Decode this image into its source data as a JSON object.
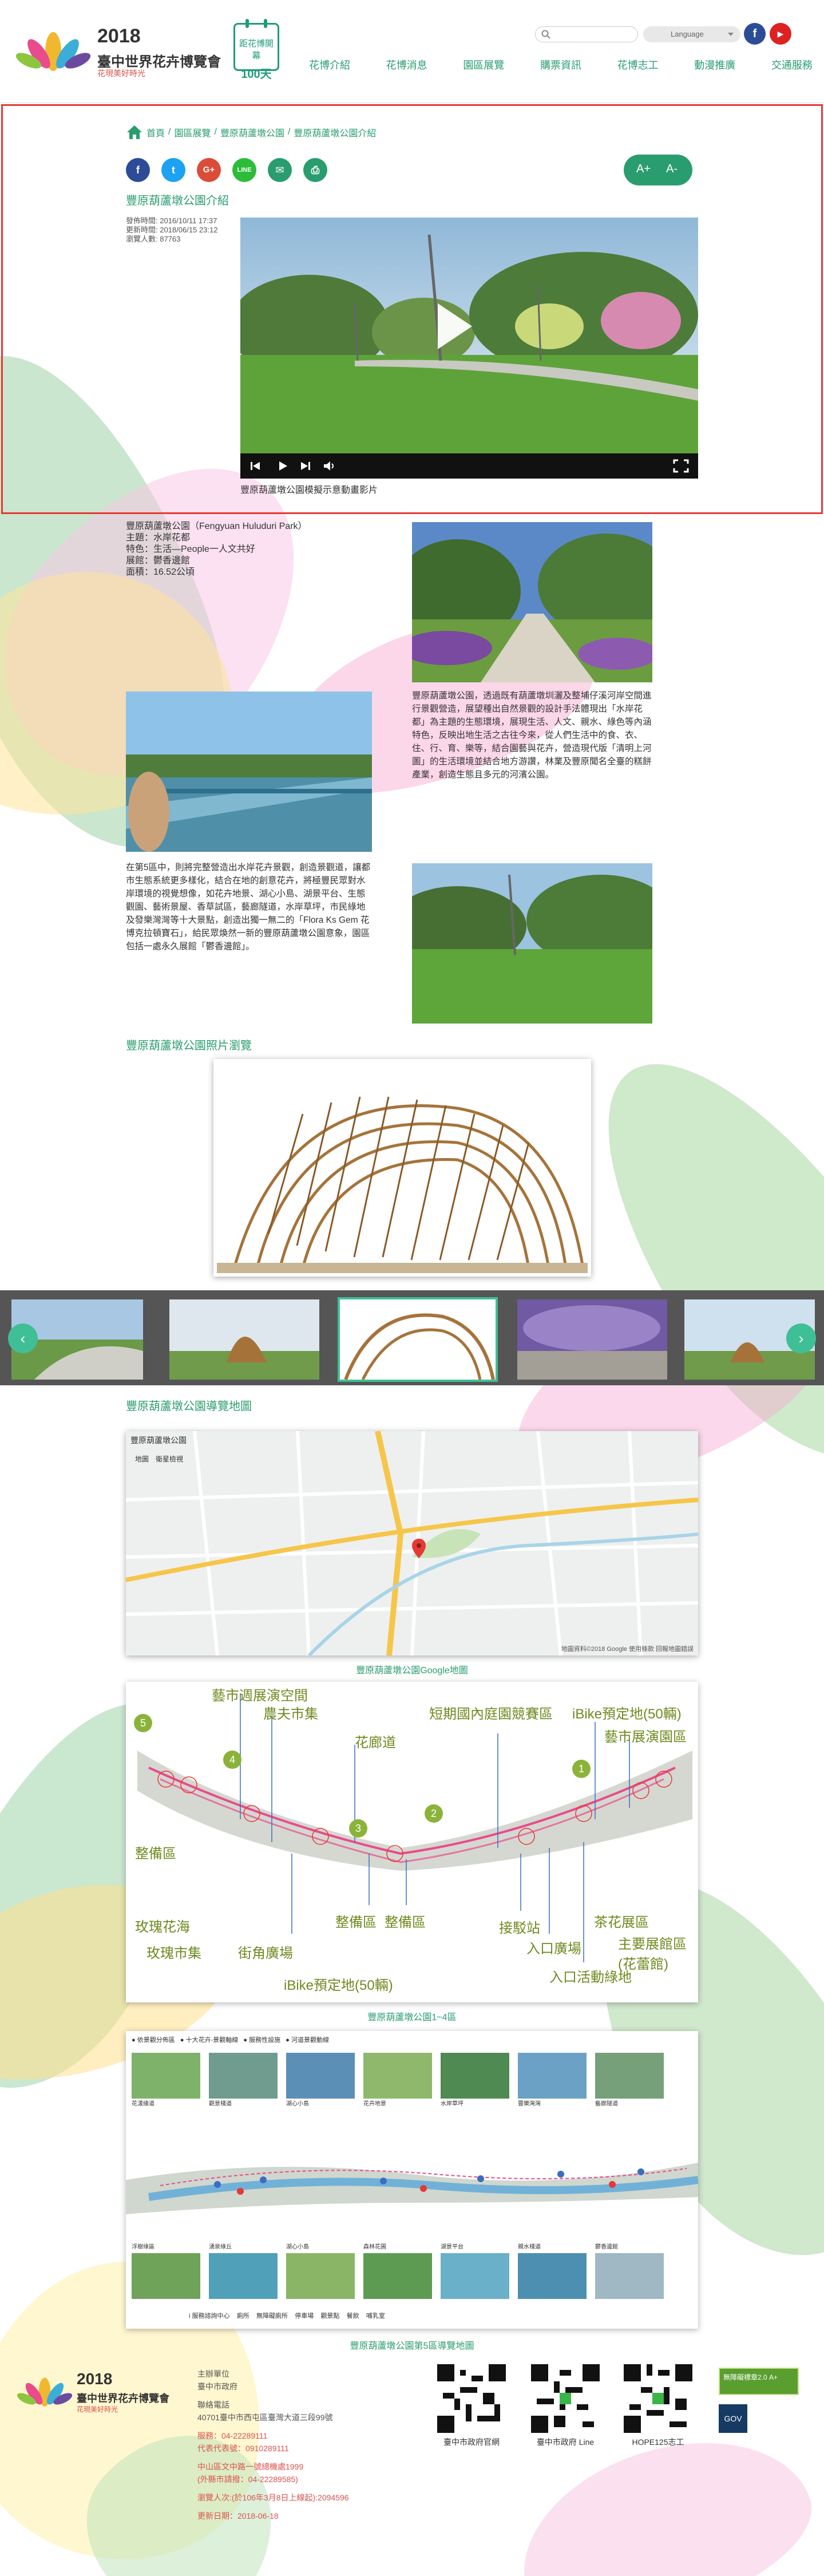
{
  "header": {
    "logo_year": "2018",
    "logo_name": "臺中世界花卉博覽會",
    "logo_sub": "花現美好時光",
    "countdown_line1": "距花博開幕",
    "countdown_line2": "100天",
    "search_placeholder": "",
    "language_label": "Language",
    "fb_label": "f",
    "yt_label": "▶",
    "nav": [
      "花博介紹",
      "花博消息",
      "園區展覽",
      "購票資訊",
      "花博志工",
      "動漫推廣",
      "交通服務"
    ]
  },
  "breadcrumb": [
    "首頁",
    "園區展覽",
    "豐原葫蘆墩公園",
    "豐原葫蘆墩公園介紹"
  ],
  "share": [
    "f",
    "t",
    "G+",
    "LINE",
    "✉",
    "⎙"
  ],
  "font_size": {
    "increase": "A+",
    "decrease": "A-"
  },
  "page": {
    "title": "豐原葫蘆墩公園介紹",
    "meta": [
      "發佈時間: 2016/10/11 17:37",
      "更新時間: 2018/06/15 23:12",
      "瀏覽人數: 87763"
    ],
    "video_caption": "豐原葫蘆墩公園模擬示意動畫影片"
  },
  "info": {
    "lines": [
      "豐原葫蘆墩公園（Fengyuan Huluduri Park）",
      "主題：水岸花都",
      "特色：生活—People一人文共好",
      "展館：鬱香邊館",
      "面積：16.52公頃"
    ],
    "para1": "豐原葫蘆墩公園，透過既有葫蘆墩圳灑及整埔仔溪河岸空間進行景觀營造，展望種出自然景觀的設計手法體現出「水岸花都」為主題的生態環境，展現生活、人文、親水、綠色等內涵特色，反映出地生活之古往今來，從人們生活中的食、衣、住、行、育、樂等，結合園藝與花卉，營造現代版「清明上河圖」的生活環境並結合地方游讚，林業及豐原聞名全臺的糕餅產業，創造生態且多元的河濱公園。",
    "para2": "在第5區中，則將完整營造出水岸花卉景觀，創造景觀道，讓都市生態系統更多樣化，結合在地的創意花卉，將極豐民眾對水岸環境的視覺想像，如花卉地景、湖心小島、湖景平台、生態觀園、藝術景屋、香草試區，藝廊隧道，水岸草坪，市民綠地及發樂灣灣等十大景點，創造出獨一無二的「Flora Ks Gem 花博克拉頓寶石」，給民眾煥然一新的豐原葫蘆墩公園意象，園區包括一處永久展館「鬱香邊館」。"
  },
  "gallery": {
    "title": "豐原葫蘆墩公園照片瀏覽",
    "prev": "‹",
    "next": "›"
  },
  "map": {
    "title": "豐原葫蘆墩公園導覽地圖",
    "embed_title": "豐原葫蘆墩公園",
    "tabs": [
      "地圖",
      "衛星檢視"
    ],
    "credit": "地圖資料©2018 Google   使用條款   回報地圖錯誤",
    "caption": "豐原葫蘆墩公園Google地圖"
  },
  "diagram": {
    "caption": "豐原葫蘆墩公園1~4區",
    "labels": [
      "藝市週展演空間",
      "農夫市集",
      "花廊道",
      "短期國內庭園競賽區",
      "iBike預定地(50輛)",
      "藝市展演園區",
      "整備區",
      "玫瑰花海",
      "玫瑰市集",
      "街角廣場",
      "整備區",
      "整備區",
      "接駁站",
      "入口廣場",
      "入口活動綠地",
      "茶花展區",
      "主要展館區(花蕾館)",
      "iBike預定地(50輛)"
    ],
    "numbers": [
      "5",
      "4",
      "3",
      "2",
      "1"
    ]
  },
  "panorama": {
    "caption": "豐原葫蘆墩公園第5區導覽地圖",
    "legend": [
      "● 依景觀分佈區",
      "● 十大花卉-景觀軸線",
      "● 服務性設施",
      "● 河道景觀動線"
    ],
    "top_names": [
      "花漾緣道",
      "觀景棧道",
      "湖心小島",
      "花卉地景",
      "水岸草坪",
      "豐樂灣灣",
      "藝廊隧道"
    ],
    "bottom_names": [
      "浮樹綠區",
      "湧泉綠丘",
      "湖心小島",
      "森林花圃",
      "湖景平台",
      "親水棧道",
      "鬱香邊館"
    ],
    "bottom_legend": [
      "i 服務諮詢中心",
      "廁所",
      "無障礙廁所",
      "停車場",
      "觀景點",
      "餐飲",
      "哺乳室"
    ]
  },
  "footer": {
    "logo_year": "2018",
    "logo_name": "臺中世界花卉博覽會",
    "logo_sub": "花現美好時光",
    "lines": [
      "主辦單位",
      "臺中市政府",
      "聯絡電話",
      "40701臺中市西屯區臺灣大道三段99號",
      "服務：04-22289111",
      "代表代表號：0910289111",
      "中山區文中路一號總機處1999",
      "(外縣市請撥：04-22289585)",
      "瀏覽人次:(於106年3月8日上線起):2094596",
      "更新日期：2018-06-18"
    ],
    "qr_captions": [
      "臺中市政府官網",
      "臺中市政府 Line",
      "HOPE125志工"
    ],
    "badge1": "無障礙標章2.0 A+",
    "badge2": "GOV"
  }
}
